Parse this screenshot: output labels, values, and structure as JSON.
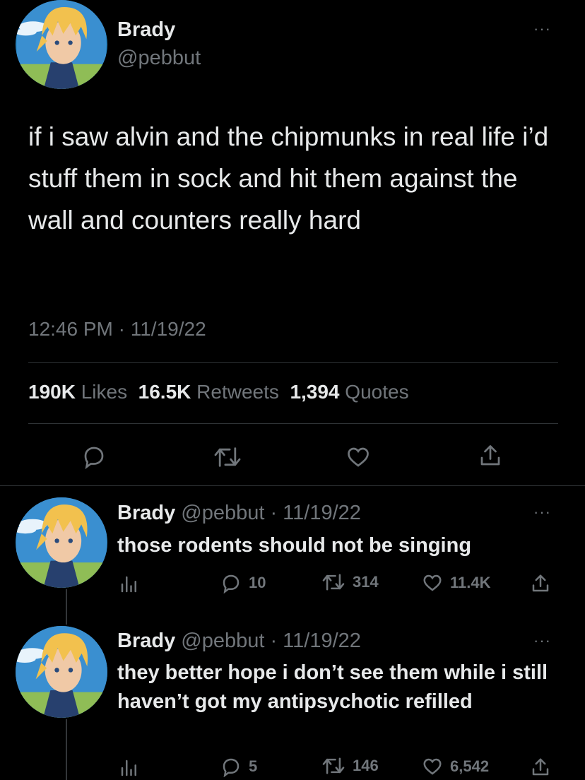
{
  "main_tweet": {
    "name": "Brady",
    "handle": "@pebbut",
    "text": "if i saw alvin and the chipmunks in real life i’d stuff them in sock and hit them against the wall and counters really hard",
    "timestamp": "12:46 PM · 11/19/22",
    "stats": {
      "likes_value": "190K",
      "likes_label": "Likes",
      "retweets_value": "16.5K",
      "retweets_label": "Retweets",
      "quotes_value": "1,394",
      "quotes_label": "Quotes"
    },
    "more_icon": "···",
    "icons": [
      "reply-icon",
      "retweet-icon",
      "like-icon",
      "share-icon"
    ]
  },
  "replies": [
    {
      "name": "Brady",
      "handle": "@pebbut · 11/19/22",
      "text": "those rodents should not be singing",
      "replies": "10",
      "retweets": "314",
      "likes": "11.4K"
    },
    {
      "name": "Brady",
      "handle": "@pebbut · 11/19/22",
      "text": "they better hope i don’t see them while i still haven’t got my antipsychotic refilled",
      "replies": "5",
      "retweets": "146",
      "likes": "6,542"
    }
  ],
  "colors": {
    "background": "#000000",
    "text": "#e7e9ea",
    "muted": "#71767b",
    "divider": "#2f3336"
  }
}
